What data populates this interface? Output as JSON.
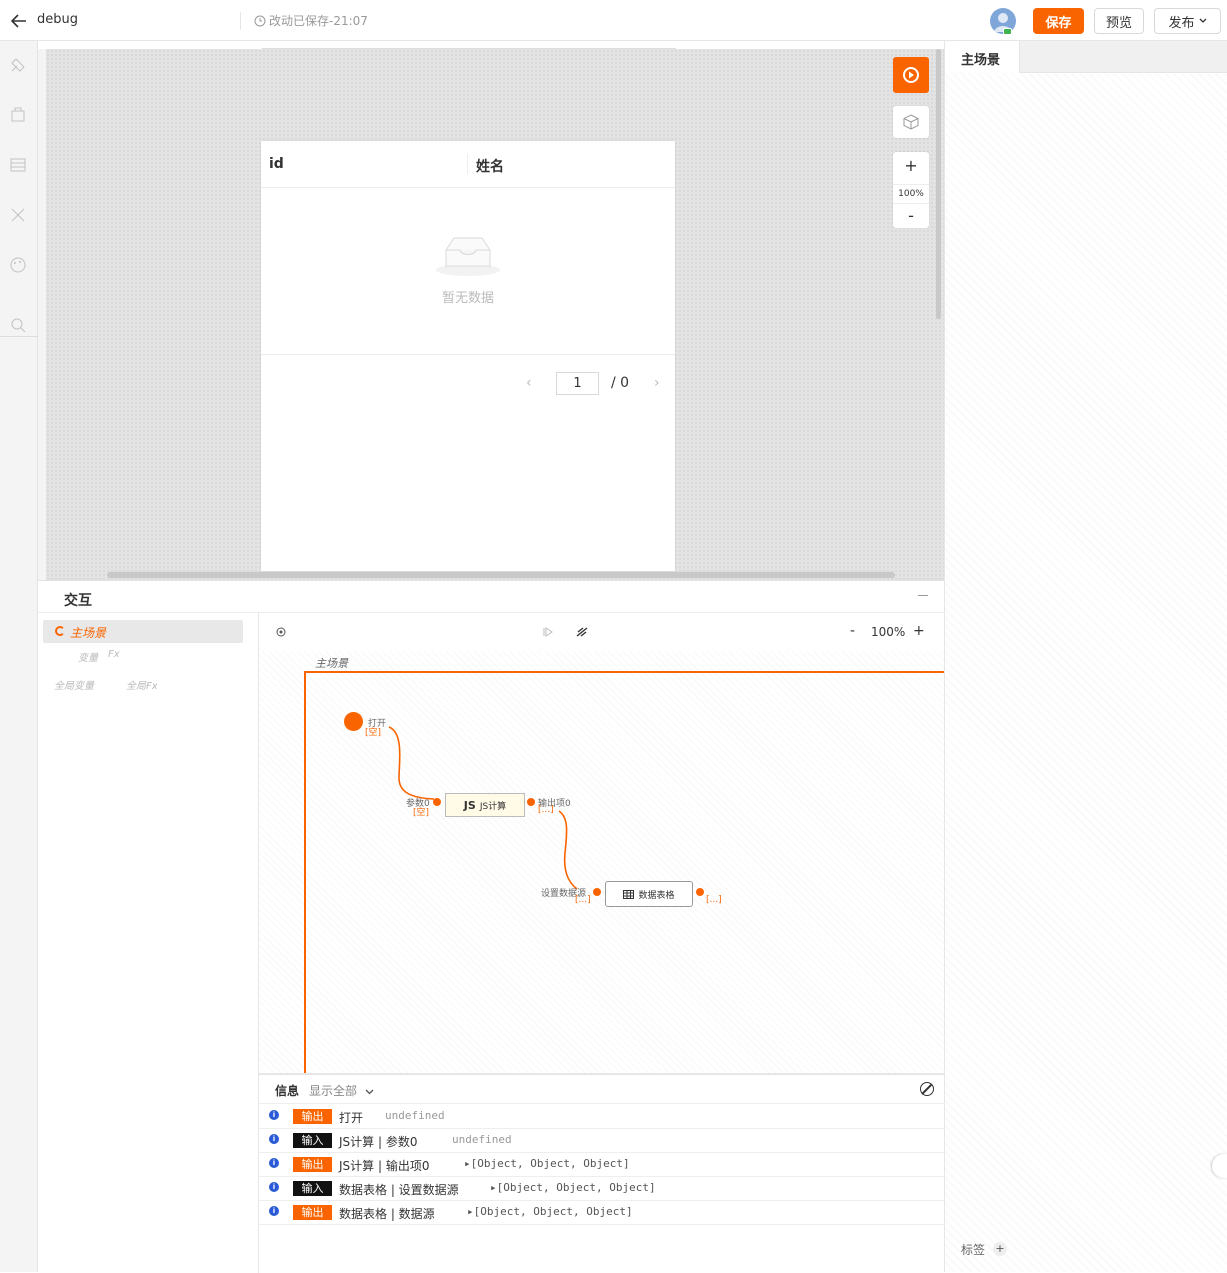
{
  "header": {
    "title": "debug",
    "save_status": "改动已保存-21:07",
    "save_label": "保存",
    "preview_label": "预览",
    "publish_label": "发布"
  },
  "canvas": {
    "table": {
      "columns": [
        "id",
        "姓名"
      ],
      "empty_text": "暂无数据",
      "pager_current": "1",
      "pager_total": "/  0"
    },
    "zoom": {
      "plus": "+",
      "level": "100%",
      "minus": "-"
    }
  },
  "right_panel": {
    "tab": "主场景",
    "tag_label": "标签",
    "tag_add": "+"
  },
  "interaction": {
    "title": "交互",
    "scene_item": "主场景",
    "sub_var": "变量",
    "sub_fx": "Fx",
    "global_var": "全局变量",
    "global_fx": "全局Fx",
    "zoom_minus": "-",
    "zoom_level": "100%",
    "zoom_plus": "+",
    "scene_frame_label": "主场景",
    "nodes": {
      "open_label": "打开",
      "open_val": "[空]",
      "param_label": "参数0",
      "param_val": "[空]",
      "js_label": "JS计算",
      "js_badge": "JS",
      "output_label": "输出项0",
      "output_val": "[...]",
      "set_ds_label": "设置数据源",
      "set_ds_val": "[...]",
      "table_label": "数据表格",
      "table_out_val": "[...]"
    },
    "log": {
      "title": "信息",
      "filter": "显示全部",
      "rows": [
        {
          "type": "输出",
          "text": "打开",
          "value": "undefined"
        },
        {
          "type": "输入",
          "text": "JS计算  |  参数0",
          "value": "undefined"
        },
        {
          "type": "输出",
          "text": "JS计算  |  输出项0",
          "value": "▸[Object, Object, Object]"
        },
        {
          "type": "输入",
          "text": "数据表格  |  设置数据源",
          "value": "▸[Object, Object, Object]"
        },
        {
          "type": "输出",
          "text": "数据表格  |  数据源",
          "value": "▸[Object, Object, Object]"
        }
      ]
    }
  },
  "colors": {
    "accent": "#fa6400",
    "input_tag": "#111111",
    "info": "#2a5bd7"
  }
}
